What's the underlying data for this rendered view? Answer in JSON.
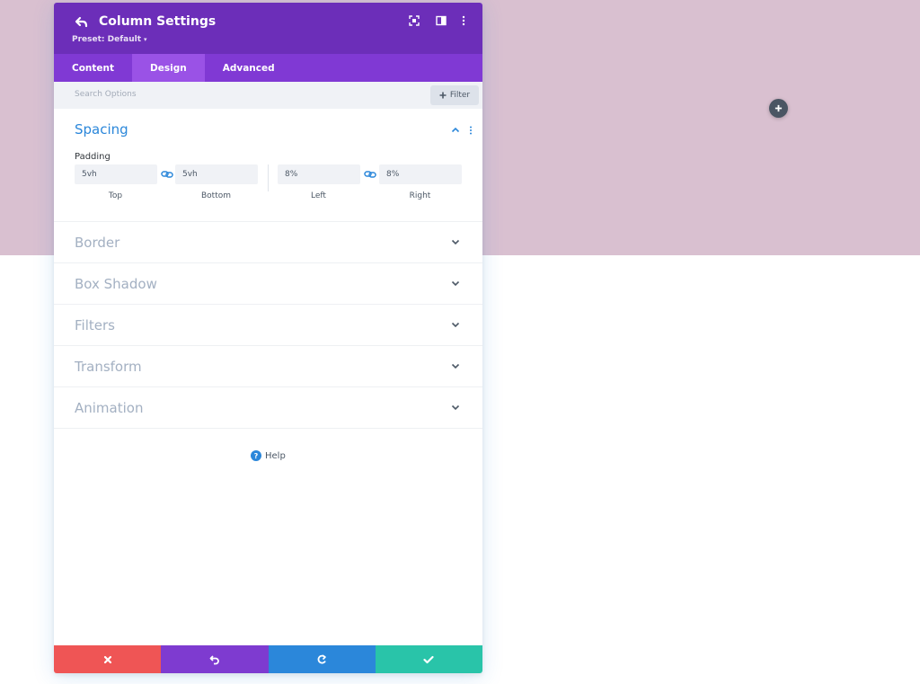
{
  "colors": {
    "page_bg_top": "#d9c0d0",
    "header_bg": "#6c2eb9",
    "tabs_bg": "#8039d4",
    "tab_active_bg": "#9a52e6",
    "accent_blue": "#2b87da",
    "cancel_red": "#ef5555",
    "undo_purple": "#7e3bd0",
    "redo_blue": "#2b87da",
    "save_teal": "#29c4a9"
  },
  "header": {
    "title": "Column Settings",
    "preset_label": "Preset: Default",
    "icons": [
      "back-icon",
      "fullscreen-icon",
      "split-view-icon",
      "more-icon"
    ]
  },
  "tabs": [
    {
      "label": "Content",
      "active": false
    },
    {
      "label": "Design",
      "active": true
    },
    {
      "label": "Advanced",
      "active": false
    }
  ],
  "search": {
    "placeholder": "Search Options",
    "filter_label": "Filter"
  },
  "spacing": {
    "title": "Spacing",
    "padding_label": "Padding",
    "fields": [
      {
        "value": "5vh",
        "caption": "Top"
      },
      {
        "value": "5vh",
        "caption": "Bottom"
      },
      {
        "value": "8%",
        "caption": "Left"
      },
      {
        "value": "8%",
        "caption": "Right"
      }
    ]
  },
  "sections": [
    {
      "title": "Border"
    },
    {
      "title": "Box Shadow"
    },
    {
      "title": "Filters"
    },
    {
      "title": "Transform"
    },
    {
      "title": "Animation"
    }
  ],
  "help_label": "Help",
  "footer": {
    "buttons": [
      "cancel",
      "undo",
      "redo",
      "save"
    ]
  }
}
